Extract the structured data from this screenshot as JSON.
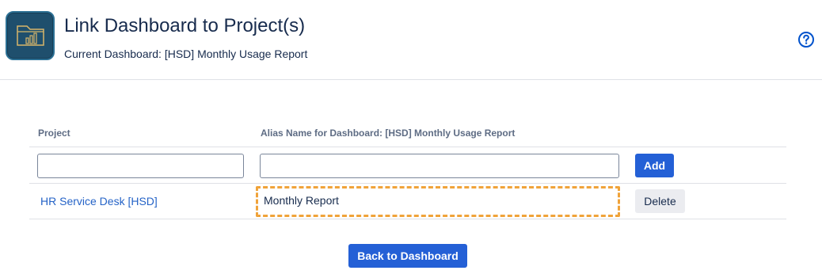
{
  "header": {
    "title": "Link Dashboard to Project(s)",
    "subtitle": "Current Dashboard: [HSD] Monthly Usage Report",
    "help_icon": "help-question-icon",
    "app_icon": "dashboard-folder-icon",
    "app_icon_color": "#1f4f6d"
  },
  "table": {
    "columns": [
      "Project",
      "Alias Name for Dashboard: [HSD] Monthly Usage Report"
    ],
    "new_row": {
      "project_value": "",
      "alias_value": "",
      "add_label": "Add"
    },
    "rows": [
      {
        "project": "HR Service Desk [HSD]",
        "alias": "Monthly Report",
        "delete_label": "Delete"
      }
    ]
  },
  "footer": {
    "back_label": "Back to Dashboard"
  },
  "colors": {
    "primary": "#2460d6",
    "link": "#2563c7",
    "highlight": "#f0a33a"
  }
}
